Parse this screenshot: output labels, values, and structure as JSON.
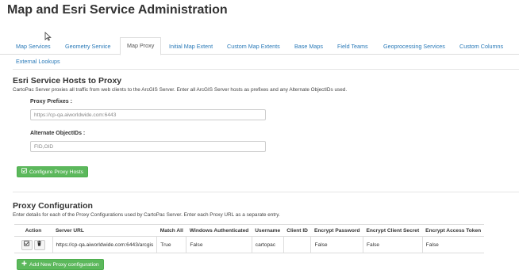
{
  "page": {
    "title": "Map and Esri Service Administration"
  },
  "tabs": [
    {
      "label": "Map Services",
      "active": false
    },
    {
      "label": "Geometry Service",
      "active": false
    },
    {
      "label": "Map Proxy",
      "active": true
    },
    {
      "label": "Initial Map Extent",
      "active": false
    },
    {
      "label": "Custom Map Extents",
      "active": false
    },
    {
      "label": "Base Maps",
      "active": false
    },
    {
      "label": "Field Teams",
      "active": false
    },
    {
      "label": "Geoprocessing Services",
      "active": false
    },
    {
      "label": "Custom Columns",
      "active": false
    },
    {
      "label": "External Lookups",
      "active": false
    }
  ],
  "hosts": {
    "heading": "Esri Service Hosts to Proxy",
    "description": "CartoPac Server proxies all traffic from web clients to the ArcGIS Server. Enter all ArcGIS Server hosts as prefixes and any Alternate ObjectIDs used.",
    "prefixes_label": "Proxy Prefixes :",
    "prefixes_value": "https://cp-qa.aiworldwide.com:6443",
    "alt_ids_label": "Alternate ObjectIDs :",
    "alt_ids_value": "FID,OID",
    "configure_button": "Configure Proxy Hosts"
  },
  "proxy_config": {
    "heading": "Proxy Configuration",
    "description": "Enter details for each of the Proxy Configurations used by CartoPac Server. Enter each Proxy URL as a separate entry.",
    "columns": [
      "Action",
      "Server URL",
      "Match All",
      "Windows Authenticated",
      "Username",
      "Client ID",
      "Encrypt Password",
      "Encrypt Client Secret",
      "Encrypt Access Token"
    ],
    "rows": [
      {
        "server_url": "https://cp-qa.aiworldwide.com:6443/arcgis",
        "match_all": "True",
        "windows_authenticated": "False",
        "username": "cartopac",
        "client_id": "",
        "encrypt_password": "False",
        "encrypt_client_secret": "False",
        "encrypt_access_token": "False"
      }
    ],
    "add_button": "Add New Proxy configuration"
  },
  "colors": {
    "link": "#2a7ab8",
    "success": "#5cb85c",
    "border": "#dddddd"
  },
  "icons": {
    "edit": "edit-icon",
    "delete": "trash-icon",
    "configure": "check-square-icon",
    "add": "plus-icon"
  }
}
